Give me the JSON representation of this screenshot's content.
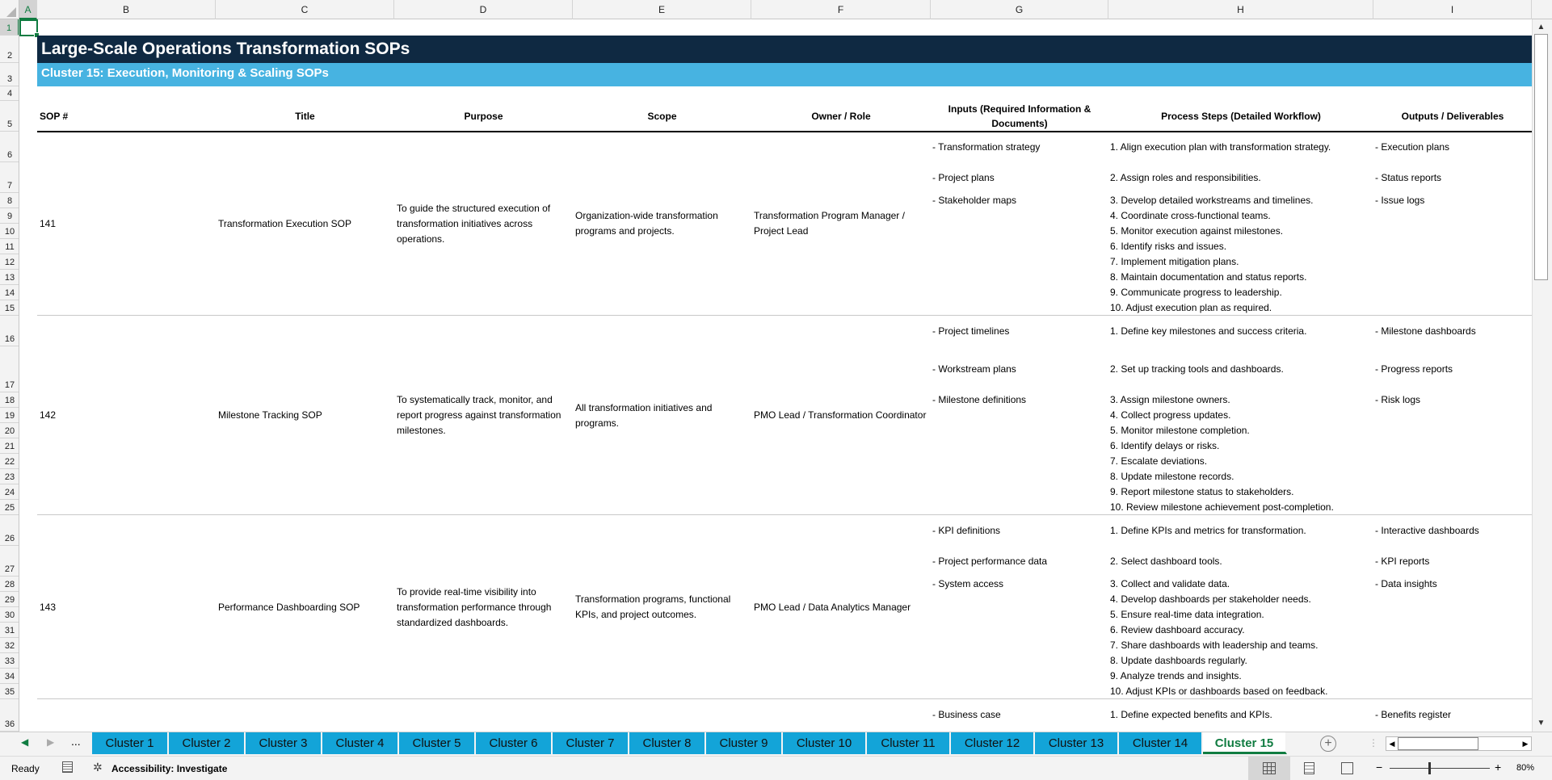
{
  "sheet": {
    "columns": [
      "A",
      "B",
      "C",
      "D",
      "E",
      "F",
      "G",
      "H",
      "I"
    ],
    "title": "Large-Scale Operations Transformation SOPs",
    "subtitle": "Cluster 15: Execution, Monitoring & Scaling SOPs",
    "headers": {
      "sop": "SOP #",
      "title": "Title",
      "purpose": "Purpose",
      "scope": "Scope",
      "owner": "Owner / Role",
      "inputs": "Inputs (Required Information & Documents)",
      "steps": "Process Steps (Detailed Workflow)",
      "outputs": "Outputs / Deliverables"
    },
    "sops": [
      {
        "id": "141",
        "title": "Transformation Execution SOP",
        "purpose": "To guide the structured execution of transformation initiatives across operations.",
        "scope": "Organization-wide transformation programs and projects.",
        "owner": "Transformation Program Manager / Project Lead",
        "inputs": [
          "- Transformation strategy",
          "- Project plans",
          "- Stakeholder maps"
        ],
        "steps": [
          "1. Align execution plan with transformation strategy.",
          "2. Assign roles and responsibilities.",
          "3. Develop detailed workstreams and timelines.",
          "4. Coordinate cross-functional teams.",
          "5. Monitor execution against milestones.",
          "6. Identify risks and issues.",
          "7. Implement mitigation plans.",
          "8. Maintain documentation and status reports.",
          "9. Communicate progress to leadership.",
          "10. Adjust execution plan as required."
        ],
        "outputs": [
          "- Execution plans",
          "- Status reports",
          "- Issue logs"
        ]
      },
      {
        "id": "142",
        "title": "Milestone Tracking SOP",
        "purpose": "To systematically track, monitor, and report progress against transformation milestones.",
        "scope": "All transformation initiatives and programs.",
        "owner": "PMO Lead / Transformation Coordinator",
        "inputs": [
          "- Project timelines",
          "- Workstream plans",
          "- Milestone definitions"
        ],
        "steps": [
          "1. Define key milestones and success criteria.",
          "2. Set up tracking tools and dashboards.",
          "3. Assign milestone owners.",
          "4. Collect progress updates.",
          "5. Monitor milestone completion.",
          "6. Identify delays or risks.",
          "7. Escalate deviations.",
          "8. Update milestone records.",
          "9. Report milestone status to stakeholders.",
          "10. Review milestone achievement post-completion."
        ],
        "outputs": [
          "- Milestone dashboards",
          "- Progress reports",
          "- Risk logs"
        ]
      },
      {
        "id": "143",
        "title": "Performance Dashboarding SOP",
        "purpose": "To provide real-time visibility into transformation performance through standardized dashboards.",
        "scope": "Transformation programs, functional KPIs, and project outcomes.",
        "owner": "PMO Lead / Data Analytics Manager",
        "inputs": [
          "- KPI definitions",
          "- Project performance data",
          "- System access"
        ],
        "steps": [
          "1. Define KPIs and metrics for transformation.",
          "2. Select dashboard tools.",
          "3. Collect and validate data.",
          "4. Develop dashboards per stakeholder needs.",
          "5. Ensure real-time data integration.",
          "6. Review dashboard accuracy.",
          "7. Share dashboards with leadership and teams.",
          "8. Update dashboards regularly.",
          "9. Analyze trends and insights.",
          "10. Adjust KPIs or dashboards based on feedback."
        ],
        "outputs": [
          "- Interactive dashboards",
          "- KPI reports",
          "- Data insights"
        ]
      }
    ],
    "partial_row": {
      "row_number": "36",
      "input": "- Business case",
      "step": "1. Define expected benefits and KPIs.",
      "output": "- Benefits register"
    }
  },
  "tabs": {
    "more": "...",
    "items": [
      "Cluster 1",
      "Cluster 2",
      "Cluster 3",
      "Cluster 4",
      "Cluster 5",
      "Cluster 6",
      "Cluster 7",
      "Cluster 8",
      "Cluster 9",
      "Cluster 10",
      "Cluster 11",
      "Cluster 12",
      "Cluster 13",
      "Cluster 14",
      "Cluster 15"
    ],
    "active": "Cluster 15"
  },
  "status": {
    "ready": "Ready",
    "accessibility": "Accessibility: Investigate",
    "zoom": "80%"
  },
  "colors": {
    "banner": "#0f2942",
    "subbanner": "#47b3e1",
    "tab": "#13a4d8",
    "accent": "#107c41"
  }
}
